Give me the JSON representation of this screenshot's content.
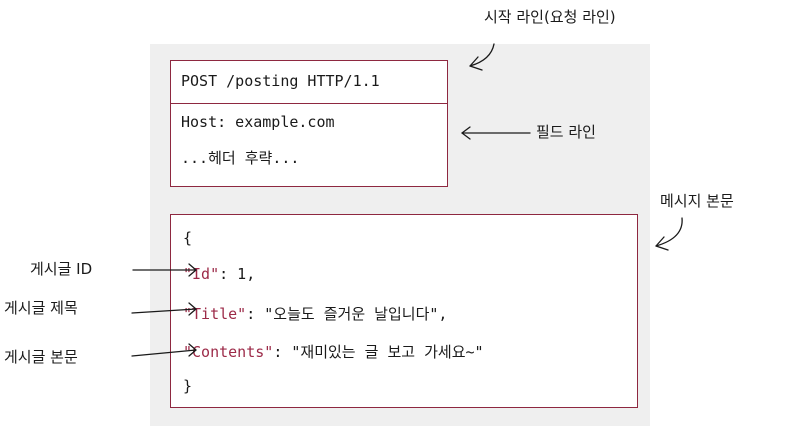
{
  "annotations": {
    "start_line": "시작 라인(요청 라인)",
    "field_line": "필드 라인",
    "message_body": "메시지 본문"
  },
  "request": {
    "start_line": "POST /posting HTTP/1.1",
    "host_header": "Host: example.com",
    "omitted": "...헤더 후략..."
  },
  "body": {
    "open_brace": "{",
    "fields": [
      {
        "label": "게시글 ID",
        "key": "\"Id\"",
        "rest": ": 1,"
      },
      {
        "label": "게시글 제목",
        "key": "\"Title\"",
        "rest": ": \"오늘도 즐거운 날입니다\","
      },
      {
        "label": "게시글 본문",
        "key": "\"Contents\"",
        "rest": ": \"재미있는 글 보고 가세요~\""
      }
    ],
    "close_brace": "}"
  },
  "colors": {
    "border": "#8e2840",
    "json_key": "#9c2a48",
    "panel_bg": "#efefef"
  }
}
